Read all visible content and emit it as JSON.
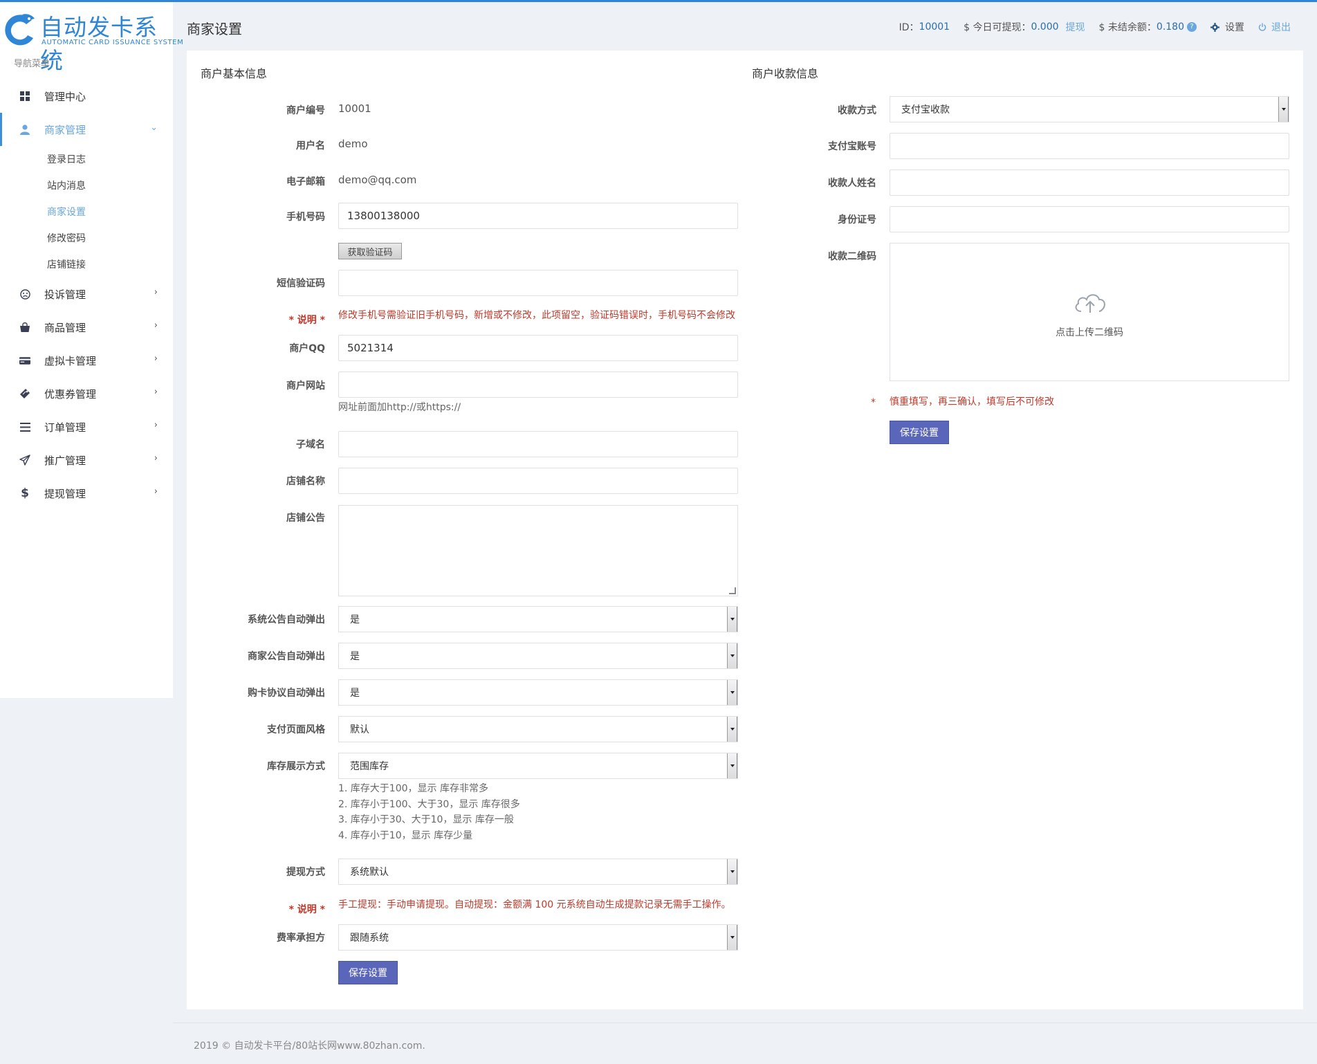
{
  "brand": {
    "name": "自动发卡系统",
    "tagline": "AUTOMATIC CARD ISSUANCE SYSTEM"
  },
  "sidebar": {
    "caption": "导航菜单",
    "items": [
      {
        "label": "管理中心",
        "icon": "dashboard-icon"
      },
      {
        "label": "商家管理",
        "icon": "user-icon",
        "expanded": true,
        "children": [
          {
            "label": "登录日志"
          },
          {
            "label": "站内消息"
          },
          {
            "label": "商家设置",
            "current": true
          },
          {
            "label": "修改密码"
          },
          {
            "label": "店铺链接"
          }
        ]
      },
      {
        "label": "投诉管理",
        "icon": "frown-icon"
      },
      {
        "label": "商品管理",
        "icon": "shopping-bag-icon"
      },
      {
        "label": "虚拟卡管理",
        "icon": "credit-card-icon"
      },
      {
        "label": "优惠券管理",
        "icon": "ticket-icon"
      },
      {
        "label": "订单管理",
        "icon": "list-icon"
      },
      {
        "label": "推广管理",
        "icon": "paper-plane-icon"
      },
      {
        "label": "提现管理",
        "icon": "dollar-icon"
      }
    ]
  },
  "header": {
    "title": "商家设置",
    "id_label": "ID：",
    "id_value": "10001",
    "withdrawable_label": "$ 今日可提现：",
    "withdrawable_value": "0.000",
    "withdraw_link": "提现",
    "unsettled_label": "$ 未结余额：",
    "unsettled_value": "0.180",
    "help_mark": "?",
    "settings_label": "设置",
    "logout_label": "退出"
  },
  "basic": {
    "section_title": "商户基本信息",
    "merchant_no_label": "商户编号",
    "merchant_no": "10001",
    "username_label": "用户名",
    "username": "demo",
    "email_label": "电子邮箱",
    "email": "demo@qq.com",
    "phone_label": "手机号码",
    "phone": "13800138000",
    "get_code_button": "获取验证码",
    "sms_code_label": "短信验证码",
    "sms_code": "",
    "note_label": "* 说明 *",
    "phone_note": "修改手机号需验证旧手机号码，新增或不修改，此项留空，验证码错误时，手机号码不会修改",
    "qq_label": "商户QQ",
    "qq": "5021314",
    "website_label": "商户网站",
    "website": "",
    "website_hint": "网址前面加http://或https://",
    "subdomain_label": "子域名",
    "subdomain": "",
    "shop_name_label": "店铺名称",
    "shop_name": "",
    "shop_notice_label": "店铺公告",
    "sys_popup_label": "系统公告自动弹出",
    "sys_popup": "是",
    "merchant_popup_label": "商家公告自动弹出",
    "merchant_popup": "是",
    "agreement_popup_label": "购卡协议自动弹出",
    "agreement_popup": "是",
    "pay_style_label": "支付页面风格",
    "pay_style": "默认",
    "stock_display_label": "库存展示方式",
    "stock_display": "范围库存",
    "stock_rules": [
      "1. 库存大于100，显示 库存非常多",
      "2. 库存小于100、大于30，显示 库存很多",
      "3. 库存小于30、大于10，显示 库存一般",
      "4. 库存小于10，显示 库存少量"
    ],
    "withdraw_method_label": "提现方式",
    "withdraw_method": "系统默认",
    "withdraw_note": "手工提现：手动申请提现。自动提现：金额满 100 元系统自动生成提款记录无需手工操作。",
    "fee_bearer_label": "费率承担方",
    "fee_bearer": "跟随系统",
    "save_button": "保存设置"
  },
  "payment": {
    "section_title": "商户收款信息",
    "method_label": "收款方式",
    "method": "支付宝收款",
    "alipay_label": "支付宝账号",
    "alipay": "",
    "payee_label": "收款人姓名",
    "payee": "",
    "id_card_label": "身份证号",
    "id_card": "",
    "qrcode_label": "收款二维码",
    "upload_text": "点击上传二维码",
    "required_mark": "*",
    "careful_note": "慎重填写，再三确认，填写后不可修改",
    "save_button": "保存设置"
  },
  "footer": {
    "text": "2019 © 自动发卡平台/80站长网www.80zhan.com."
  }
}
